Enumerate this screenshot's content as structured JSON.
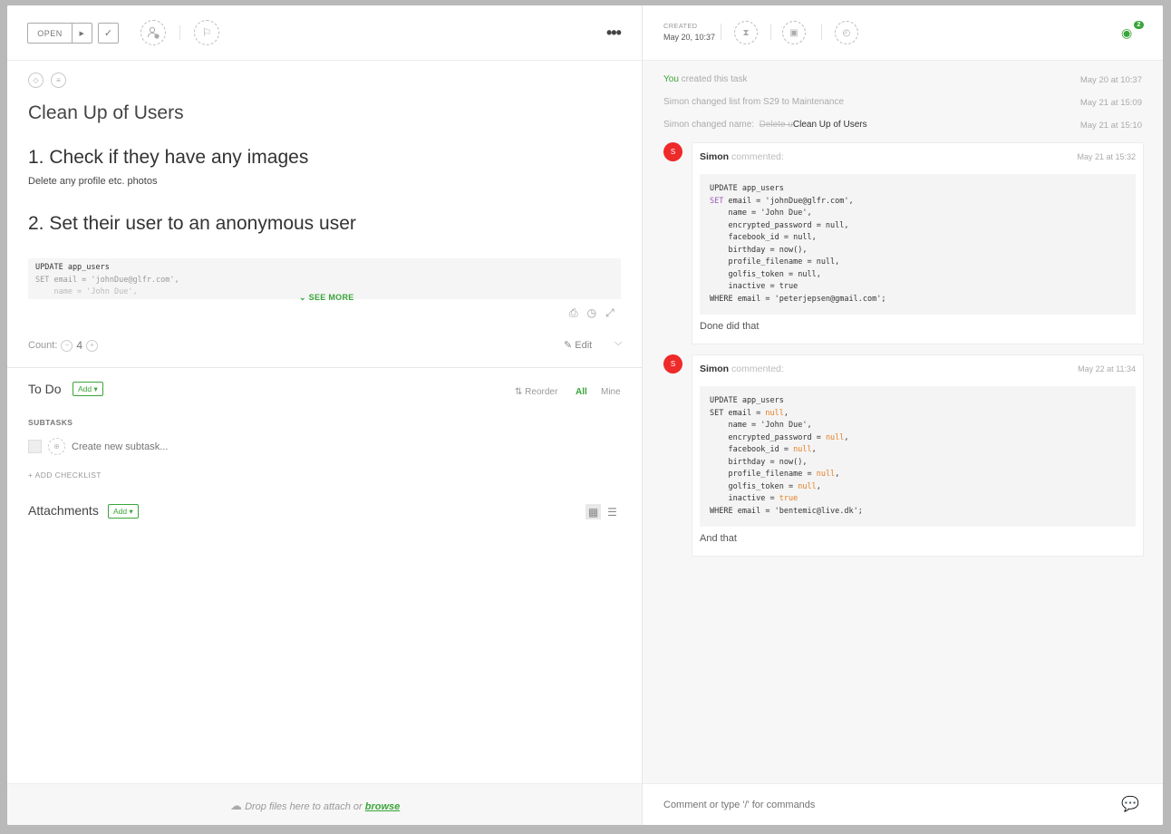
{
  "header": {
    "status_label": "OPEN",
    "more_label": "•••"
  },
  "task": {
    "title": "Clean Up of Users",
    "heading1": "1. Check if they have any images",
    "para1": "Delete any profile etc. photos",
    "heading2": "2. Set their user to an anonymous user",
    "code_line1": "UPDATE app_users",
    "code_line2": "SET email = 'johnDue@glfr.com',",
    "code_line3": "    name = 'John Due',",
    "see_more": "SEE MORE"
  },
  "count": {
    "label": "Count:",
    "value": "4",
    "edit_label": "Edit"
  },
  "todo": {
    "title": "To Do",
    "add_label": "Add ▾",
    "reorder_label": "Reorder",
    "filter_all": "All",
    "filter_mine": "Mine",
    "subtasks_heading": "SUBTASKS",
    "new_subtask_placeholder": "Create new subtask...",
    "add_checklist": "+ ADD CHECKLIST"
  },
  "attachments": {
    "title": "Attachments",
    "add_label": "Add ▾",
    "drop_text": "Drop files here to attach or",
    "browse_label": "browse"
  },
  "sidebar": {
    "created_label": "CREATED",
    "created_value": "May 20, 10:37",
    "watchers": "2"
  },
  "activity": [
    {
      "actor": "You",
      "text": " created this task",
      "date": "May 20 at 10:37"
    },
    {
      "actor": "",
      "text": "Simon changed list from S29 to Maintenance",
      "date": "May 21 at 15:09"
    },
    {
      "actor": "",
      "text": "Simon changed name:",
      "old": "Delete u",
      "new": "Clean Up of Users",
      "date": "May 21 at 15:10"
    }
  ],
  "comments": [
    {
      "avatar": "S",
      "author": "Simon",
      "verb": "commented:",
      "date": "May 21 at 15:32",
      "message": "Done did that"
    },
    {
      "avatar": "S",
      "author": "Simon",
      "verb": "commented:",
      "date": "May 22 at 11:34",
      "message": "And that"
    }
  ],
  "comment_box": {
    "placeholder": "Comment or type '/' for commands"
  },
  "colors": {
    "accent": "#3aa53a",
    "avatar": "#ee2a2a"
  }
}
